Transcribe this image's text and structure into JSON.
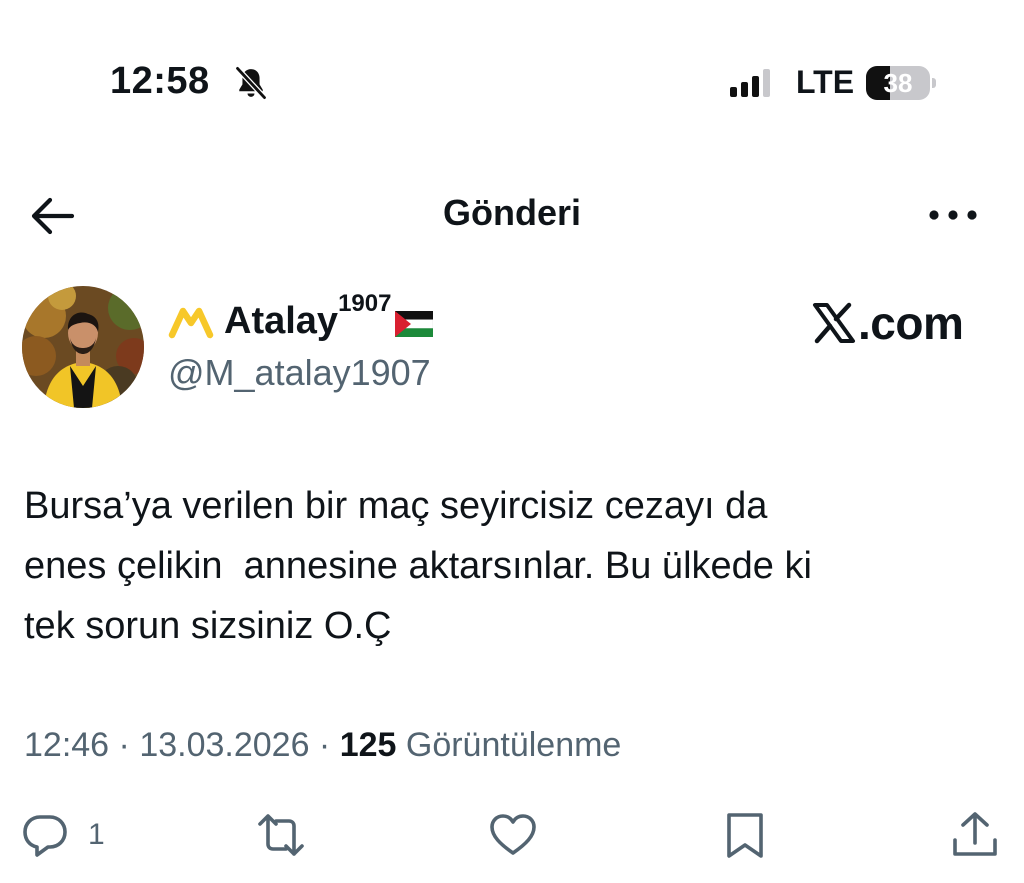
{
  "status_bar": {
    "time": "12:58",
    "network": "LTE",
    "battery_level": 38,
    "battery_text": "38"
  },
  "nav": {
    "title": "Gönderi"
  },
  "post": {
    "author": {
      "display_name": "Atalay",
      "display_name_suffix": "1907",
      "handle": "@M_atalay1907"
    },
    "watermark": ".com",
    "text": "Bursa’ya verilen bir maç seyircisiz cezayı da\nenes çelikin  annesine aktarsınlar. Bu ülkede ki\ntek sorun sizsiniz O.Ç",
    "time": "12:46",
    "date": "13.03.2026",
    "separator": " · ",
    "views_count": "125",
    "views_label": " Görüntülenme"
  },
  "actions": {
    "reply_count": "1"
  },
  "icons": {
    "back": "arrow-left-icon",
    "more": "more-horizontal-icon",
    "bell_muted": "bell-slash-icon",
    "brand": "brand-mark-icon",
    "flag": "palestine-flag-icon",
    "reply": "reply-icon",
    "retweet": "retweet-icon",
    "like": "heart-icon",
    "bookmark": "bookmark-icon",
    "share": "share-icon"
  },
  "colors": {
    "text_primary": "#0f1419",
    "text_secondary": "#536471",
    "brand_yellow": "#f7c82a"
  }
}
